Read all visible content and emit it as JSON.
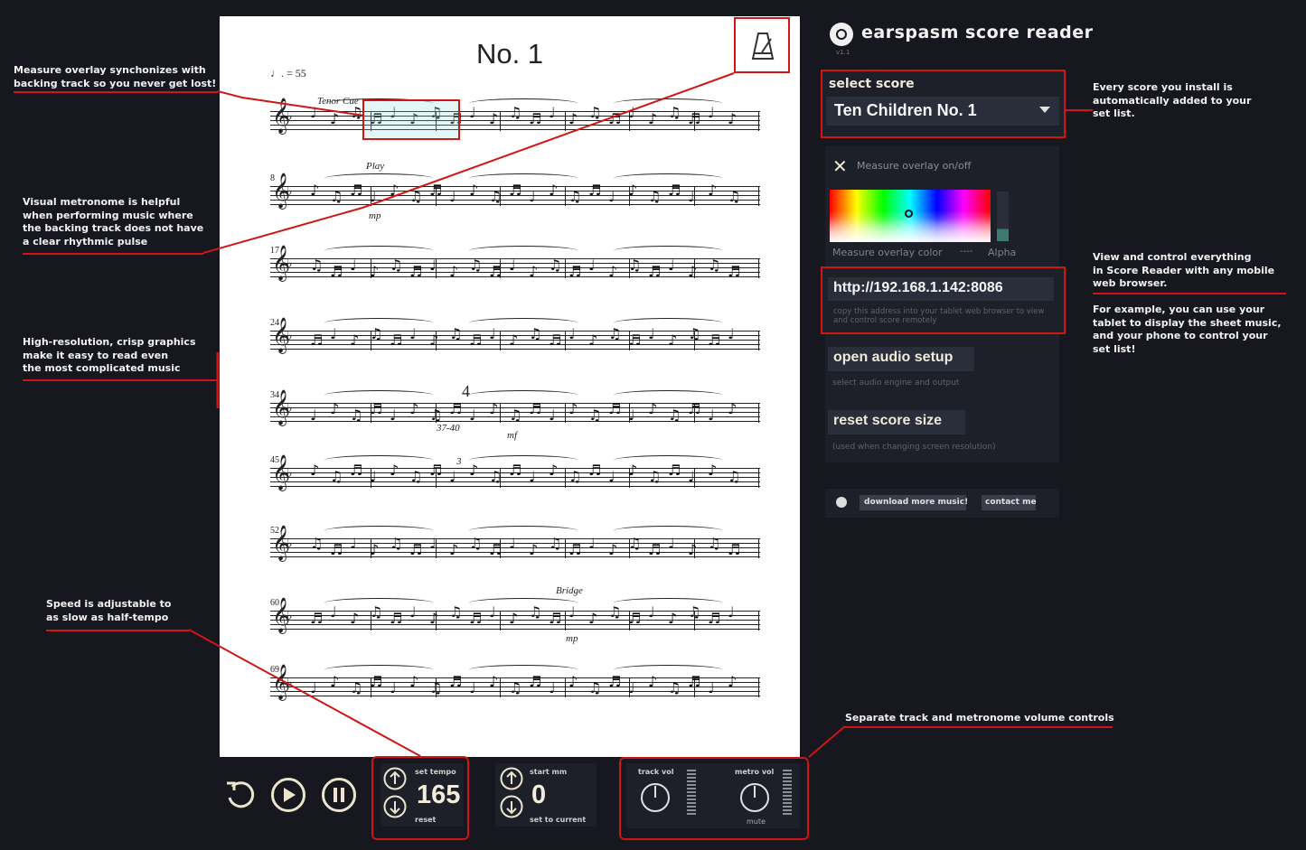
{
  "score": {
    "title": "No. 1",
    "tempo_marking": "♩. = 55",
    "header_texts": [
      "Tenor Cue",
      "Play",
      "mp",
      "4",
      "37-40",
      "mf",
      "3",
      "Bridge",
      "mp"
    ],
    "measure_numbers": [
      "8",
      "17",
      "24",
      "34",
      "45",
      "52",
      "60",
      "69"
    ]
  },
  "app": {
    "title": "earspasm score reader",
    "version": "v1.1"
  },
  "select_score": {
    "label": "select score",
    "value": "Ten Children No. 1"
  },
  "overlay": {
    "toggle_label": "Measure overlay on/off",
    "color_label": "Measure overlay color",
    "separator": "----",
    "alpha_label": "Alpha"
  },
  "remote": {
    "url": "http://192.168.1.142:8086",
    "hint": "copy this address into your tablet web browser to view and control score remotely"
  },
  "audio": {
    "button_label": "open audio setup",
    "hint": "select audio engine and output"
  },
  "reset": {
    "button_label": "reset score size",
    "hint": "(used when changing screen resolution)"
  },
  "footer": {
    "download_label": "download more music!",
    "contact_label": "contact me"
  },
  "transport": {
    "tempo_label": "set tempo",
    "tempo_value": "165",
    "tempo_reset": "reset",
    "startmm_label": "start mm",
    "startmm_value": "0",
    "startmm_set": "set to current",
    "track_vol_label": "track vol",
    "metro_vol_label": "metro vol",
    "mute_label": "mute"
  },
  "annotations": {
    "a1": [
      "Measure overlay synchonizes with",
      "backing track so you never get lost!"
    ],
    "a2": [
      "Visual metronome is helpful",
      "when performing music where",
      "the backing track does not have",
      "a clear rhythmic pulse"
    ],
    "a3": [
      "High-resolution, crisp graphics",
      "make it easy to read even",
      "the most complicated music"
    ],
    "a4": [
      "Speed is adjustable to",
      "as slow as half-tempo"
    ],
    "a5": [
      "Every score you install is",
      "automatically added to your",
      "set list."
    ],
    "a6": [
      "View and control everything",
      "in Score Reader with any mobile",
      "web browser."
    ],
    "a7": [
      "For example, you can use your",
      "tablet to display the sheet music,",
      "and your phone to control your",
      "set list!"
    ],
    "a8": [
      "Separate track and metronome volume controls"
    ]
  },
  "colors": {
    "background": "#16171f",
    "panel": "#1e2029",
    "highlight_red": "#d01515",
    "button_text": "#f0ead8"
  }
}
